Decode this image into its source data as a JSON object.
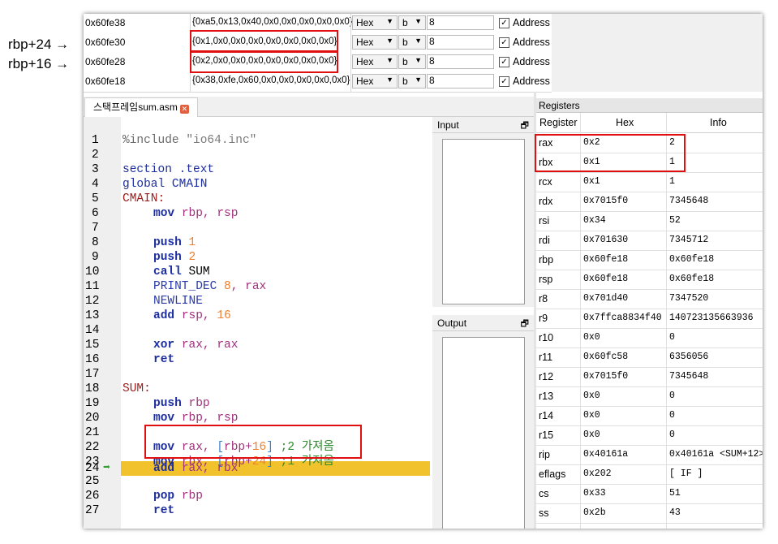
{
  "annotations": {
    "rbp24": "rbp+24 →",
    "rbp16": "rbp+16 →"
  },
  "memory": {
    "rows": [
      {
        "address": "0x60fe38",
        "value": "{0xa5,0x13,0x40,0x0,0x0,0x0,0x0,0x0}",
        "format": "Hex",
        "size": "b",
        "count": "8",
        "address_checked": true,
        "address_label": "Address"
      },
      {
        "address": "0x60fe30",
        "value": "{0x1,0x0,0x0,0x0,0x0,0x0,0x0,0x0}",
        "format": "Hex",
        "size": "b",
        "count": "8",
        "address_checked": true,
        "address_label": "Address"
      },
      {
        "address": "0x60fe28",
        "value": "{0x2,0x0,0x0,0x0,0x0,0x0,0x0,0x0}",
        "format": "Hex",
        "size": "b",
        "count": "8",
        "address_checked": true,
        "address_label": "Address"
      },
      {
        "address": "0x60fe18",
        "value": "{0x38,0xfe,0x60,0x0,0x0,0x0,0x0,0x0}",
        "format": "Hex",
        "size": "b",
        "count": "8",
        "address_checked": true,
        "address_label": "Address"
      }
    ]
  },
  "tab": {
    "label": "스택프레임sum.asm",
    "close": "✕"
  },
  "editor": {
    "line_numbers": [
      "1",
      "2",
      "3",
      "4",
      "5",
      "6",
      "7",
      "8",
      "9",
      "10",
      "11",
      "12",
      "13",
      "14",
      "15",
      "16",
      "17",
      "18",
      "19",
      "20",
      "21",
      "22",
      "23",
      "24",
      "25",
      "26",
      "27"
    ],
    "current_line": "24",
    "current_arrow": "➡",
    "code": {
      "l1_a": "%include ",
      "l1_b": "\"io64.inc\"",
      "l3_a": "section ",
      "l3_b": ".text",
      "l4_a": "global ",
      "l4_b": "CMAIN",
      "l5": "CMAIN:",
      "l6_i": "mov",
      "l6_r1": "rbp",
      "l6_c": ", ",
      "l6_r2": "rsp",
      "l8_i": "push",
      "l8_n": "1",
      "l9_i": "push",
      "l9_n": "2",
      "l10_i": "call",
      "l10_t": "SUM",
      "l11_m": "PRINT_DEC",
      "l11_n": "8",
      "l11_c": ", ",
      "l11_r": "rax",
      "l12_m": "NEWLINE",
      "l13_i": "add",
      "l13_r": "rsp",
      "l13_c": ", ",
      "l13_n": "16",
      "l15_i": "xor",
      "l15_r1": "rax",
      "l15_c": ", ",
      "l15_r2": "rax",
      "l16_i": "ret",
      "l18": "SUM:",
      "l19_i": "push",
      "l19_r": "rbp",
      "l20_i": "mov",
      "l20_r1": "rbp",
      "l20_c": ", ",
      "l20_r2": "rsp",
      "l22_i": "mov",
      "l22_r": "rax",
      "l22_c": ", ",
      "l22_b1": "[",
      "l22_br": "rbp",
      "l22_p": "+",
      "l22_n": "16",
      "l22_b2": "]",
      "l22_cm": ";2 가져옴",
      "l23_i": "mov",
      "l23_r": "rbx",
      "l23_c": ", ",
      "l23_b1": "[",
      "l23_br": "rbp",
      "l23_p": "+",
      "l23_n": "24",
      "l23_b2": "]",
      "l23_cm": ";1 가져옴",
      "l24_i": "add",
      "l24_r1": "rax",
      "l24_c": ", ",
      "l24_r2": "rbx",
      "l26_i": "pop",
      "l26_r": "rbp",
      "l27_i": "ret"
    }
  },
  "input_pane": {
    "title": "Input",
    "pin": "🗗"
  },
  "output_pane": {
    "title": "Output",
    "pin": "🗗"
  },
  "registers": {
    "title": "Registers",
    "headers": {
      "register": "Register",
      "hex": "Hex",
      "info": "Info"
    },
    "rows": [
      {
        "name": "rax",
        "hex": "0x2",
        "info": "2"
      },
      {
        "name": "rbx",
        "hex": "0x1",
        "info": "1"
      },
      {
        "name": "rcx",
        "hex": "0x1",
        "info": "1"
      },
      {
        "name": "rdx",
        "hex": "0x7015f0",
        "info": "7345648"
      },
      {
        "name": "rsi",
        "hex": "0x34",
        "info": "52"
      },
      {
        "name": "rdi",
        "hex": "0x701630",
        "info": "7345712"
      },
      {
        "name": "rbp",
        "hex": "0x60fe18",
        "info": "0x60fe18"
      },
      {
        "name": "rsp",
        "hex": "0x60fe18",
        "info": "0x60fe18"
      },
      {
        "name": "r8",
        "hex": "0x701d40",
        "info": "7347520"
      },
      {
        "name": "r9",
        "hex": "0x7ffca8834f40",
        "info": "140723135663936"
      },
      {
        "name": "r10",
        "hex": "0x0",
        "info": "0"
      },
      {
        "name": "r11",
        "hex": "0x60fc58",
        "info": "6356056"
      },
      {
        "name": "r12",
        "hex": "0x7015f0",
        "info": "7345648"
      },
      {
        "name": "r13",
        "hex": "0x0",
        "info": "0"
      },
      {
        "name": "r14",
        "hex": "0x0",
        "info": "0"
      },
      {
        "name": "r15",
        "hex": "0x0",
        "info": "0"
      },
      {
        "name": "rip",
        "hex": "0x40161a",
        "info": "0x40161a <SUM+12>"
      },
      {
        "name": "eflags",
        "hex": "0x202",
        "info": "[ IF ]"
      },
      {
        "name": "cs",
        "hex": "0x33",
        "info": "51"
      },
      {
        "name": "ss",
        "hex": "0x2b",
        "info": "43"
      }
    ]
  },
  "colors": {
    "highlight_box": "#e01010",
    "current_line": "#f2c22c",
    "arrow": "#2e9e2e"
  }
}
